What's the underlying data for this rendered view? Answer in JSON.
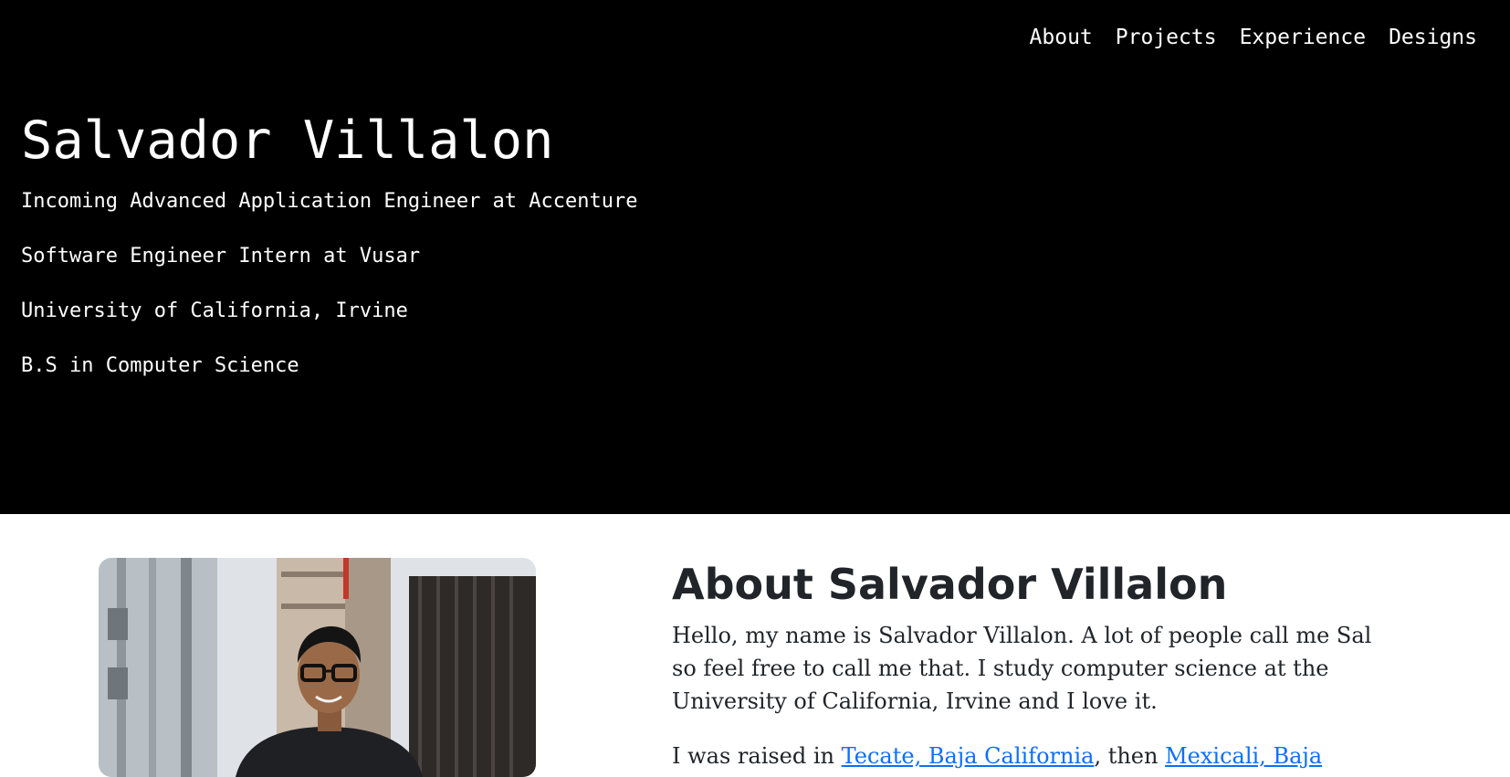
{
  "nav": {
    "items": [
      {
        "label": "About"
      },
      {
        "label": "Projects"
      },
      {
        "label": "Experience"
      },
      {
        "label": "Designs"
      }
    ]
  },
  "hero": {
    "name": "Salvador Villalon",
    "lines": [
      "Incoming Advanced Application Engineer at Accenture",
      "Software Engineer Intern at Vusar",
      "University of California, Irvine",
      "B.S in Computer Science"
    ]
  },
  "about": {
    "title": "About Salvador Villalon",
    "paragraph1": "Hello, my name is Salvador Villalon. A lot of people call me Sal so feel free to call me that. I study computer science at the University of California, Irvine and I love it.",
    "paragraph2": {
      "prefix": "I was raised in ",
      "link1": "Tecate, Baja California",
      "mid": ", then ",
      "link2": "Mexicali, Baja"
    }
  },
  "colors": {
    "hero_bg": "#000000",
    "hero_text": "#ffffff",
    "body_text": "#212529",
    "link": "#0d6efd"
  }
}
